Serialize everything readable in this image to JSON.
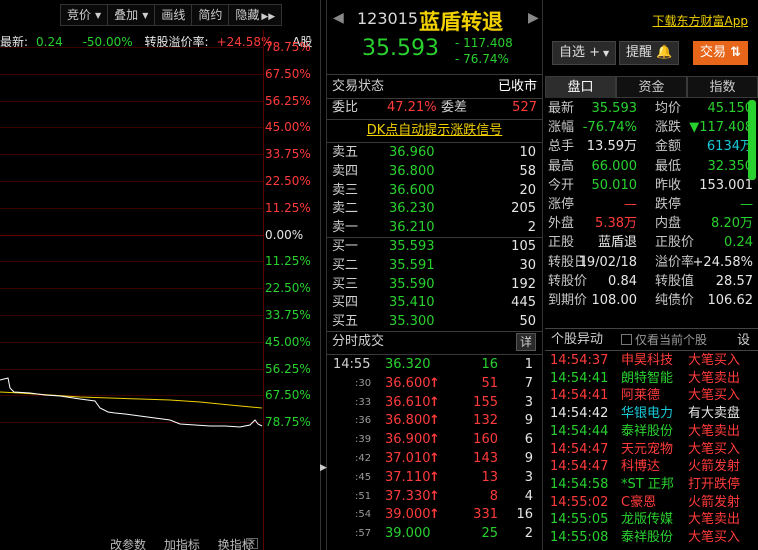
{
  "toolbar": {
    "items": [
      {
        "label": "竞价",
        "caret": true
      },
      {
        "label": "叠加",
        "caret": true
      },
      {
        "label": "画线",
        "caret": false
      },
      {
        "label": "简约",
        "caret": false
      },
      {
        "label": "隐藏",
        "caret": false,
        "suffix": "▶▶"
      }
    ]
  },
  "chart": {
    "info": {
      "latest_label": "最新:",
      "latest": "0.24",
      "change": "-50.00%",
      "premium_label": "转股溢价率:",
      "premium": "+24.58%",
      "series": "A股"
    },
    "pct_labels": [
      "78.75%",
      "67.50%",
      "56.25%",
      "45.00%",
      "33.75%",
      "22.50%",
      "11.25%",
      "0.00%",
      "11.25%",
      "22.50%",
      "33.75%",
      "45.00%",
      "56.25%",
      "67.50%",
      "78.75%"
    ],
    "bottom_links": [
      "改参数",
      "加指标",
      "换指标"
    ],
    "colors": {
      "up": "#ff3b3b",
      "down": "#29d12f",
      "avg": "#f0d000",
      "price": "#ffffff"
    }
  },
  "stock": {
    "code": "123015",
    "name": "蓝盾转退",
    "price": "35.593",
    "change": "- 117.408",
    "change_pct": "- 76.74%"
  },
  "actions": {
    "download": "下载东方财富App",
    "watchlist": "自选 +",
    "alert": "提醒",
    "trade": "交易"
  },
  "status": {
    "label": "交易状态",
    "value": "已收市"
  },
  "weibi": {
    "label1": "委比",
    "value1": "47.21%",
    "label2": "委差",
    "value2": "527"
  },
  "dk_link": "DK点自动提示涨跌信号",
  "sells": [
    {
      "label": "卖五",
      "price": "36.960",
      "vol": "10"
    },
    {
      "label": "卖四",
      "price": "36.800",
      "vol": "58"
    },
    {
      "label": "卖三",
      "price": "36.600",
      "vol": "20"
    },
    {
      "label": "卖二",
      "price": "36.230",
      "vol": "205"
    },
    {
      "label": "卖一",
      "price": "36.210",
      "vol": "2"
    }
  ],
  "buys": [
    {
      "label": "买一",
      "price": "35.593",
      "vol": "105"
    },
    {
      "label": "买二",
      "price": "35.591",
      "vol": "30"
    },
    {
      "label": "买三",
      "price": "35.590",
      "vol": "192"
    },
    {
      "label": "买四",
      "price": "35.410",
      "vol": "445"
    },
    {
      "label": "买五",
      "price": "35.300",
      "vol": "50"
    }
  ],
  "ticks_header": {
    "title": "分时成交",
    "detail": "详"
  },
  "ticks": [
    {
      "time": "14:55",
      "price": "36.320",
      "arrow": "",
      "vol": "16",
      "count": "1"
    },
    {
      "time": ":30",
      "price": "36.600",
      "arrow": "↑",
      "vol": "51",
      "count": "7"
    },
    {
      "time": ":33",
      "price": "36.610",
      "arrow": "↑",
      "vol": "155",
      "count": "3"
    },
    {
      "time": ":36",
      "price": "36.800",
      "arrow": "↑",
      "vol": "132",
      "count": "9"
    },
    {
      "time": ":39",
      "price": "36.900",
      "arrow": "↑",
      "vol": "160",
      "count": "6"
    },
    {
      "time": ":42",
      "price": "37.010",
      "arrow": "↑",
      "vol": "143",
      "count": "9"
    },
    {
      "time": ":45",
      "price": "37.110",
      "arrow": "↑",
      "vol": "13",
      "count": "3"
    },
    {
      "time": ":51",
      "price": "37.330",
      "arrow": "↑",
      "vol": "8",
      "count": "4"
    },
    {
      "time": ":54",
      "price": "39.000",
      "arrow": "↑",
      "vol": "331",
      "count": "16"
    },
    {
      "time": ":57",
      "price": "39.000",
      "arrow": "",
      "vol": "25",
      "count": "2"
    }
  ],
  "tabs": [
    "盘口",
    "资金",
    "指数"
  ],
  "quote": [
    {
      "l1": "最新",
      "v1": "35.593",
      "c1": "green",
      "l2": "均价",
      "v2": "45.150",
      "c2": "green"
    },
    {
      "l1": "涨幅",
      "v1": "-76.74%",
      "c1": "green",
      "l2": "涨跌",
      "v2": "▼117.408",
      "c2": "green"
    },
    {
      "l1": "总手",
      "v1": "13.59万",
      "c1": "white",
      "l2": "金额",
      "v2": "6134万",
      "c2": "cyan"
    },
    {
      "l1": "最高",
      "v1": "66.000",
      "c1": "green",
      "l2": "最低",
      "v2": "32.350",
      "c2": "green"
    },
    {
      "l1": "今开",
      "v1": "50.010",
      "c1": "green",
      "l2": "昨收",
      "v2": "153.001",
      "c2": "white"
    },
    {
      "l1": "涨停",
      "v1": "—",
      "c1": "red",
      "l2": "跌停",
      "v2": "—",
      "c2": "green"
    },
    {
      "l1": "外盘",
      "v1": "5.38万",
      "c1": "red",
      "l2": "内盘",
      "v2": "8.20万",
      "c2": "green"
    },
    {
      "l1": "正股",
      "v1": "蓝盾退",
      "c1": "white",
      "l2": "正股价",
      "v2": "0.24",
      "c2": "green"
    },
    {
      "l1": "转股日",
      "v1": "19/02/18",
      "c1": "white",
      "l2": "溢价率",
      "v2": "+24.58%",
      "c2": "white"
    },
    {
      "l1": "转股价",
      "v1": "0.84",
      "c1": "white",
      "l2": "转股值",
      "v2": "28.57",
      "c2": "white"
    },
    {
      "l1": "到期价",
      "v1": "108.00",
      "c1": "white",
      "l2": "纯债价",
      "v2": "106.62",
      "c2": "white"
    }
  ],
  "yidong": {
    "title": "个股异动",
    "checkbox_label": "仅看当前个股",
    "settings": "设"
  },
  "events": [
    {
      "time": "14:54:37",
      "name": "申昊科技",
      "type": "大笔买入",
      "tc": "red",
      "nc": "red",
      "ec": "red"
    },
    {
      "time": "14:54:41",
      "name": "朗特智能",
      "type": "大笔卖出",
      "tc": "green",
      "nc": "green",
      "ec": "red"
    },
    {
      "time": "14:54:41",
      "name": "阿莱德",
      "type": "大笔买入",
      "tc": "red",
      "nc": "red",
      "ec": "red"
    },
    {
      "time": "14:54:42",
      "name": "华银电力",
      "type": "有大卖盘",
      "tc": "white",
      "nc": "cyan",
      "ec": "white"
    },
    {
      "time": "14:54:44",
      "name": "泰祥股份",
      "type": "大笔卖出",
      "tc": "green",
      "nc": "green",
      "ec": "red"
    },
    {
      "time": "14:54:47",
      "name": "天元宠物",
      "type": "大笔买入",
      "tc": "red",
      "nc": "red",
      "ec": "red"
    },
    {
      "time": "14:54:47",
      "name": "科博达",
      "type": "火箭发射",
      "tc": "red",
      "nc": "red",
      "ec": "red"
    },
    {
      "time": "14:54:58",
      "name": "*ST 正邦",
      "type": "打开跌停",
      "tc": "green",
      "nc": "green",
      "ec": "red"
    },
    {
      "time": "14:55:02",
      "name": "C豪恩",
      "type": "火箭发射",
      "tc": "red",
      "nc": "red",
      "ec": "red"
    },
    {
      "time": "14:55:05",
      "name": "龙版传媒",
      "type": "大笔卖出",
      "tc": "green",
      "nc": "green",
      "ec": "red"
    },
    {
      "time": "14:55:08",
      "name": "泰祥股份",
      "type": "大笔买入",
      "tc": "green",
      "nc": "green",
      "ec": "red"
    }
  ]
}
